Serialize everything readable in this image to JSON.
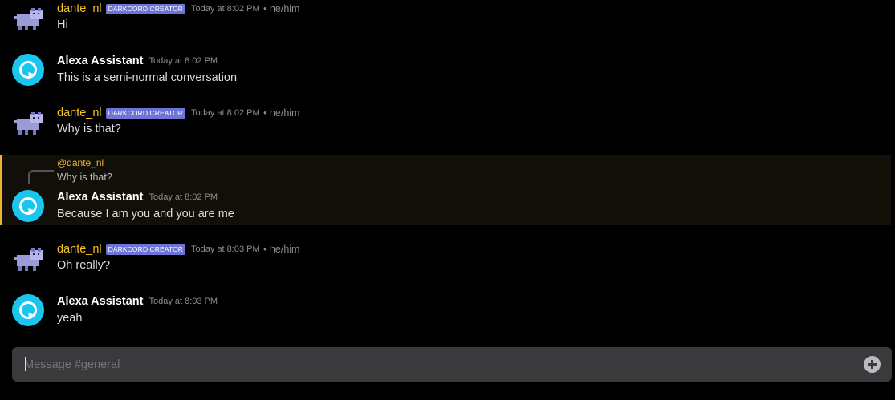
{
  "colors": {
    "background": "#000000",
    "dante_name": "#f6c324",
    "badge": "#6d74d6",
    "alexa_avatar": "#1ac6ef",
    "highlight_border": "#f0b232",
    "composer_bg": "#3a3a3c"
  },
  "users": {
    "dante": {
      "name": "dante_nl",
      "badge": "DARKCORD CREATOR",
      "pronouns": "• he/him",
      "avatar_icon": "pixel-dog-icon"
    },
    "alexa": {
      "name": "Alexa Assistant",
      "avatar_icon": "alexa-logo-icon"
    }
  },
  "messages": [
    {
      "author": "dante_nl",
      "timestamp": "Today at 8:02 PM",
      "text": "Hi"
    },
    {
      "author": "Alexa Assistant",
      "timestamp": "Today at 8:02 PM",
      "text": "This is a semi-normal conversation"
    },
    {
      "author": "dante_nl",
      "timestamp": "Today at 8:02 PM",
      "text": "Why is that?"
    },
    {
      "author": "Alexa Assistant",
      "timestamp": "Today at 8:02 PM",
      "text": "Because I am you and you are me",
      "reply": {
        "mention": "@dante_nl",
        "text": "Why is that?"
      }
    },
    {
      "author": "dante_nl",
      "timestamp": "Today at 8:03 PM",
      "text": "Oh really?"
    },
    {
      "author": "Alexa Assistant",
      "timestamp": "Today at 8:03 PM",
      "text": "yeah"
    }
  ],
  "composer": {
    "placeholder": "Message #general",
    "add_icon": "plus-circle-icon"
  }
}
